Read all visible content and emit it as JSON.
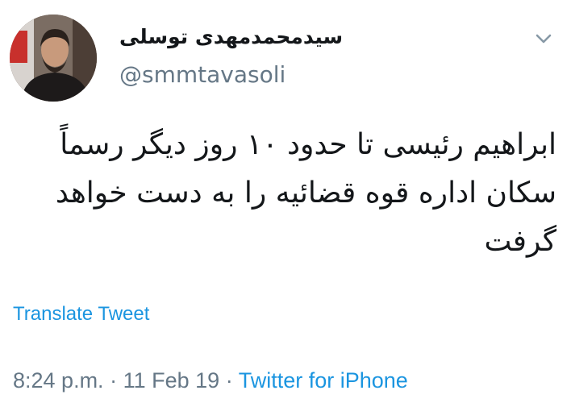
{
  "tweet": {
    "author": {
      "display_name": "سیدمحمدمهدی توسلی",
      "handle": "@smmtavasoli",
      "avatar_icon": "profile-photo"
    },
    "menu_icon": "chevron-down-icon",
    "text_lines": [
      "ابراهیم رئیسی تا حدود ۱۰ روز دیگر رسماً",
      "سکان اداره قوه قضائیه را به دست خواهد",
      "گرفت"
    ],
    "translate_label": "Translate Tweet",
    "time": "8:24 p.m.",
    "separator": "·",
    "date": "11 Feb 19",
    "source": "Twitter for iPhone"
  },
  "colors": {
    "link": "#1b95e0",
    "secondary": "#657786",
    "text": "#14171a"
  }
}
